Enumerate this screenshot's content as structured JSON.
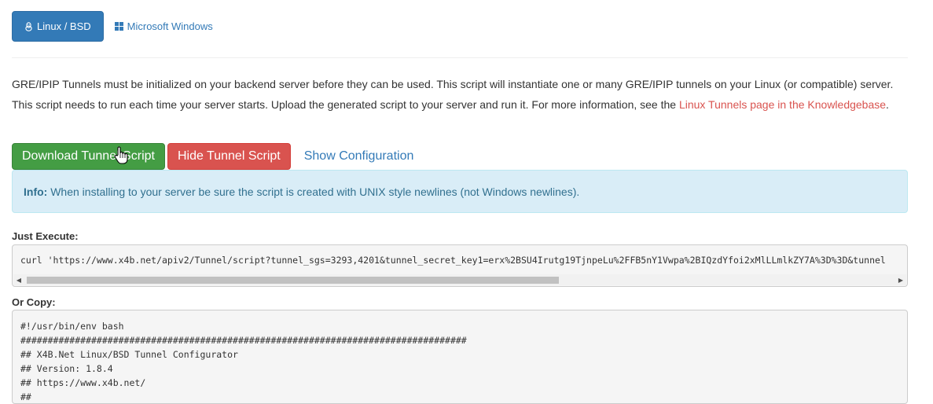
{
  "tabs": {
    "linux": {
      "label": "Linux / BSD",
      "icon": "penguin-icon",
      "active": true
    },
    "windows": {
      "label": "Microsoft Windows",
      "icon": "windows-logo-icon",
      "active": false
    }
  },
  "intro": {
    "text": "GRE/IPIP Tunnels must be initialized on your backend server before they can be used. This script will instantiate one or many GRE/IPIP tunnels on your Linux (or compatible) server. This script needs to run each time your server starts. Upload the generated script to your server and run it. For more information, see the ",
    "link_text": "Linux Tunnels page in the Knowledgebase",
    "after_link": "."
  },
  "buttons": {
    "download": "Download Tunnel Script",
    "hide": "Hide Tunnel Script",
    "show_config": "Show Configuration"
  },
  "alert": {
    "strong": "Info:",
    "text": " When installing to your server be sure the script is created with UNIX style newlines (not Windows newlines)."
  },
  "just_execute": {
    "label": "Just Execute:",
    "command": "curl 'https://www.x4b.net/apiv2/Tunnel/script?tunnel_sgs=3293,4201&tunnel_secret_key1=erx%2BSU4Irutg19TjnpeLu%2FFB5nY1Vwpa%2BIQzdYfoi2xMlLLmlkZY7A%3D%3D&tunnel"
  },
  "or_copy": {
    "label": "Or Copy:",
    "lines": [
      "#!/usr/bin/env bash",
      "##################################################################################",
      "## X4B.Net Linux/BSD Tunnel Configurator",
      "## Version: 1.8.4",
      "## https://www.x4b.net/",
      "##"
    ]
  },
  "colors": {
    "primary": "#337ab7",
    "success": "#449d44",
    "danger": "#d9534f",
    "info_bg": "#d9edf7",
    "info_text": "#31708f"
  }
}
